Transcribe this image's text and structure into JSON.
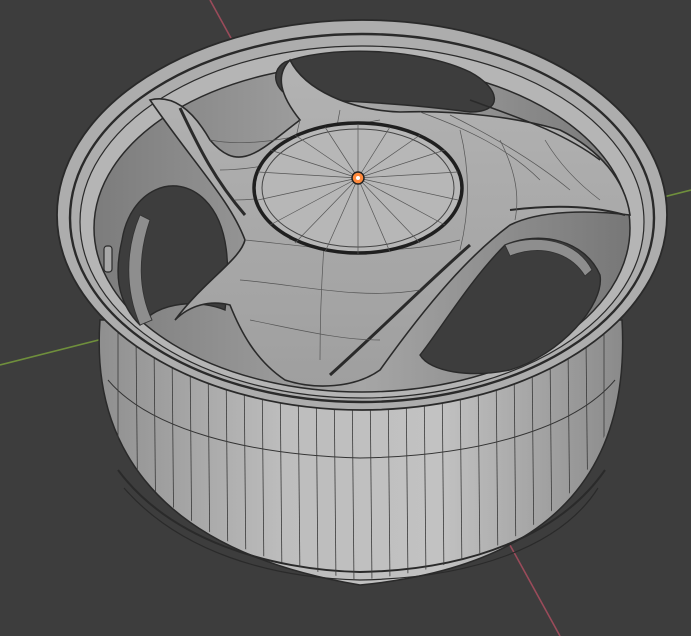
{
  "viewport": {
    "background": "#3d3d3d",
    "axes": {
      "x_color": "#9a4b5a",
      "y_color": "#6f8f3c"
    },
    "object": {
      "mesh_type": "wheel-rim",
      "spoke_count": 3,
      "shading": "solid-wireframe",
      "surface_color": "#b9b9b9",
      "edge_color": "#2a2a2a",
      "origin_color": "#ff8a3d"
    }
  }
}
